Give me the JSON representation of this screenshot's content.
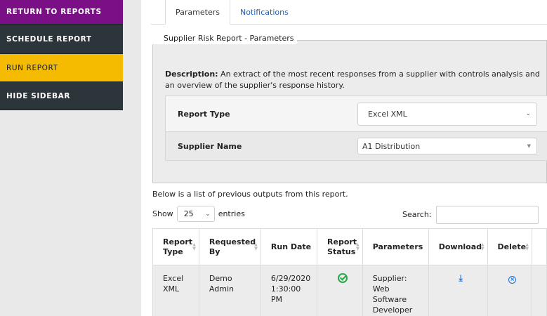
{
  "sidebar": {
    "items": [
      {
        "label": "RETURN TO REPORTS"
      },
      {
        "label": "SCHEDULE REPORT"
      },
      {
        "label": "RUN REPORT"
      },
      {
        "label": "HIDE SIDEBAR"
      }
    ]
  },
  "tabs": [
    {
      "label": "Parameters"
    },
    {
      "label": "Notifications"
    }
  ],
  "params": {
    "legend": "Supplier Risk Report - Parameters",
    "description_label": "Description:",
    "description_text": "An extract of the most recent responses from a supplier with controls analysis and an overview of the supplier's response history.",
    "report_type_label": "Report Type",
    "report_type_value": "Excel XML",
    "supplier_name_label": "Supplier Name",
    "supplier_name_value": "A1 Distribution"
  },
  "outputs": {
    "intro": "Below is a list of previous outputs from this report.",
    "show_label": "Show",
    "entries_value": "25",
    "entries_label": "entries",
    "search_label": "Search:",
    "columns": [
      "Report Type",
      "Requested By",
      "Run Date",
      "Report Status",
      "Parameters",
      "Download",
      "Delete"
    ],
    "rows": [
      {
        "report_type": "Excel XML",
        "requested_by": "Demo Admin",
        "run_date": "6/29/2020 1:30:00 PM",
        "status_icon": "check-circle-icon",
        "parameters": "Supplier: Web Software Developer",
        "download_icon": "download-icon",
        "delete_icon": "delete-circle-icon"
      }
    ]
  },
  "colors": {
    "purple": "#7b0f86",
    "dark": "#2c3539",
    "gold": "#f4bb00",
    "link": "#1f5fb5",
    "success": "#28a745"
  }
}
